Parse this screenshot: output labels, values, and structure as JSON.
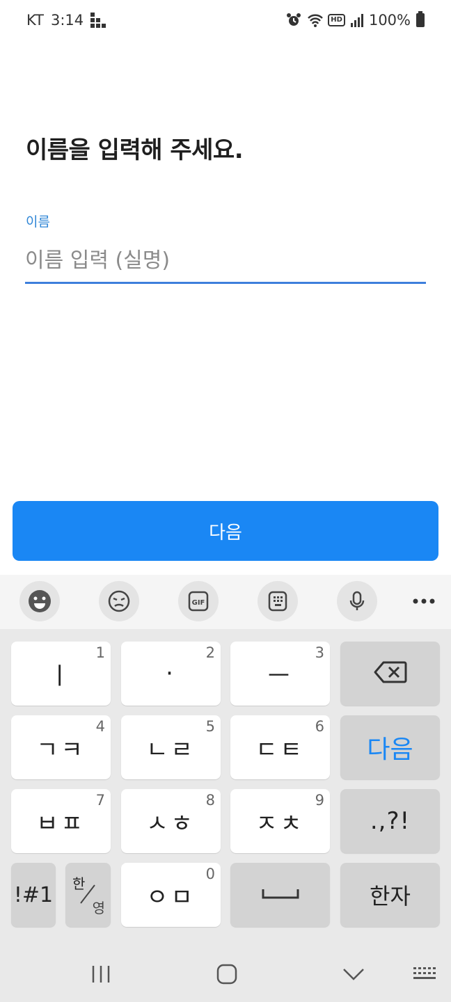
{
  "status_bar": {
    "carrier": "KT",
    "time": "3:14",
    "battery": "100%",
    "icons": [
      "alarm-icon",
      "wifi-icon",
      "hd-voice-icon",
      "signal-icon",
      "battery-icon"
    ],
    "hd_label": "HD"
  },
  "page": {
    "title": "이름을 입력해 주세요.",
    "field_label": "이름",
    "input_placeholder": "이름 입력 (실명)",
    "input_value": "",
    "next_button": "다음"
  },
  "keyboard": {
    "toolbar": [
      "emoji-icon",
      "sticker-icon",
      "gif-icon",
      "clipboard-icon",
      "mic-icon",
      "more-icon"
    ],
    "gif_label": "GIF",
    "rows": [
      [
        {
          "label": "ㅣ",
          "num": "1"
        },
        {
          "label": "·",
          "num": "2"
        },
        {
          "label": "ㅡ",
          "num": "3"
        },
        {
          "label": "backspace"
        }
      ],
      [
        {
          "label": "ㄱㅋ",
          "num": "4"
        },
        {
          "label": "ㄴㄹ",
          "num": "5"
        },
        {
          "label": "ㄷㅌ",
          "num": "6"
        },
        {
          "label": "다음"
        }
      ],
      [
        {
          "label": "ㅂㅍ",
          "num": "7"
        },
        {
          "label": "ㅅㅎ",
          "num": "8"
        },
        {
          "label": "ㅈㅊ",
          "num": "9"
        },
        {
          "label": ".,?!"
        }
      ],
      [
        {
          "label": "!#1"
        },
        {
          "label_top": "한",
          "label_bottom": "영"
        },
        {
          "label": "ㅇㅁ",
          "num": "0"
        },
        {
          "label": "space"
        },
        {
          "label": "한자"
        }
      ]
    ]
  },
  "colors": {
    "accent": "#1a87f4",
    "label_blue": "#2f86d6",
    "underline": "#3d7fdc",
    "keyboard_bg": "#e9e9e9",
    "toolbar_bg": "#f5f5f5",
    "key_gray": "#d3d3d3"
  }
}
